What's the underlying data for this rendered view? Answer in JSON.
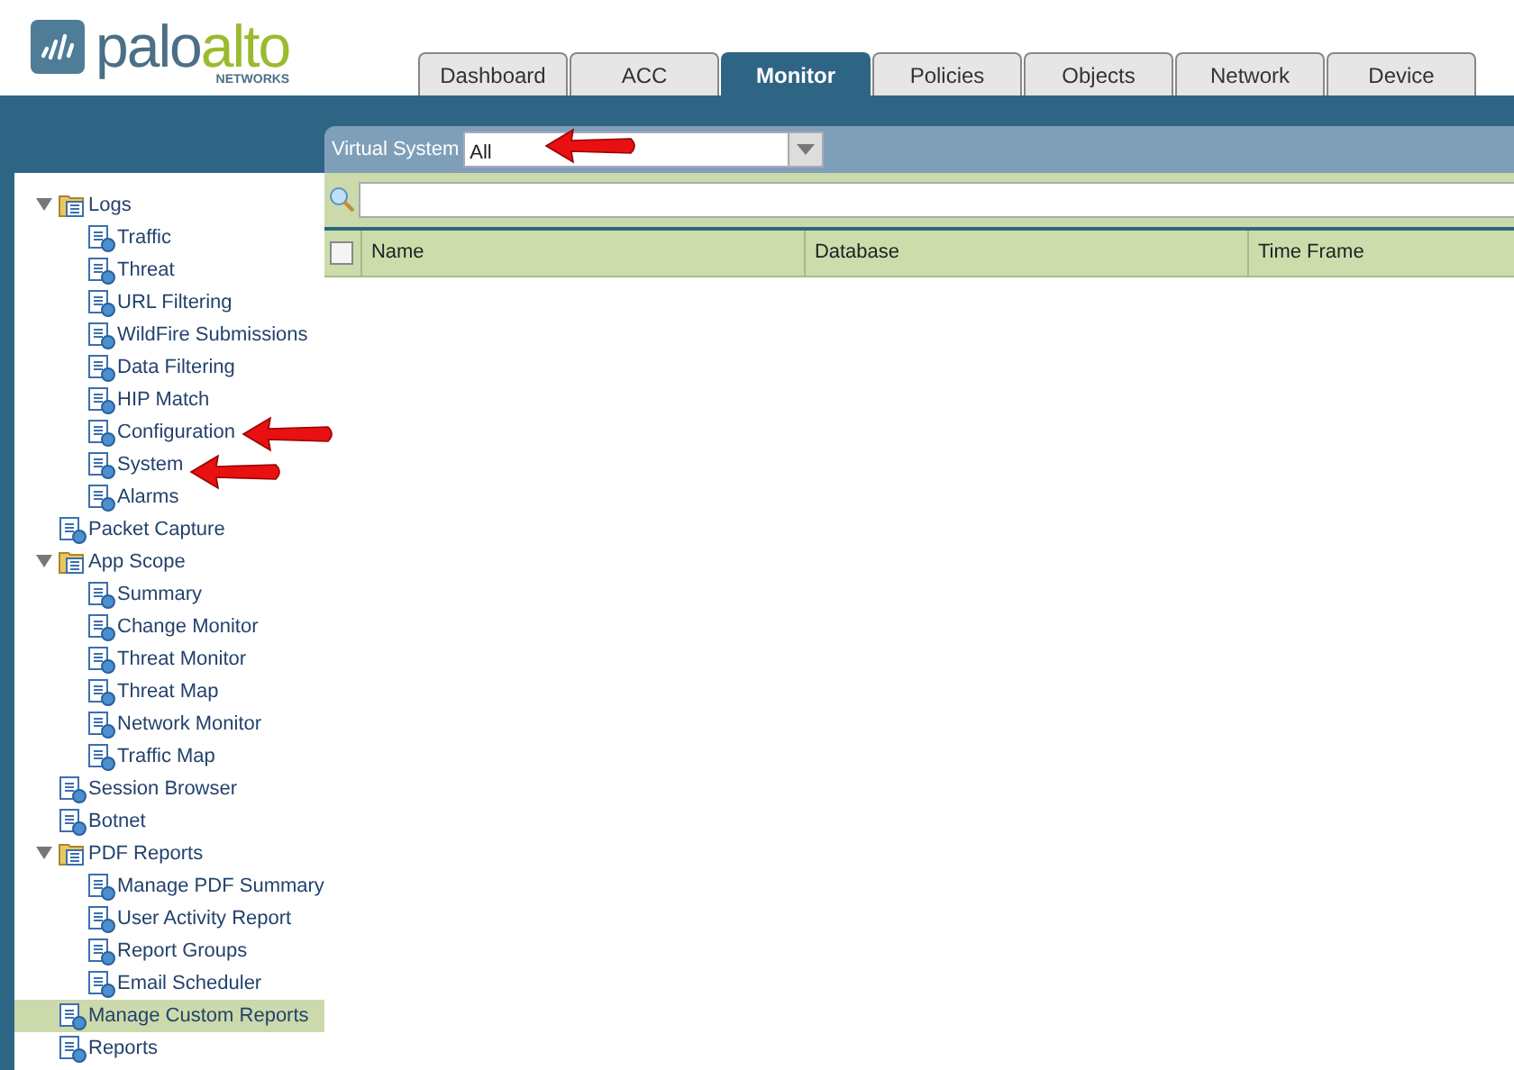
{
  "logo": {
    "word_1": "palo",
    "word_2": "alto",
    "subtitle": "NETWORKS"
  },
  "tabs": [
    {
      "label": "Dashboard",
      "selected": false
    },
    {
      "label": "ACC",
      "selected": false
    },
    {
      "label": "Monitor",
      "selected": true
    },
    {
      "label": "Policies",
      "selected": false
    },
    {
      "label": "Objects",
      "selected": false
    },
    {
      "label": "Network",
      "selected": false
    },
    {
      "label": "Device",
      "selected": false
    }
  ],
  "tree": [
    {
      "label": "Logs",
      "expanded": true,
      "selected": false,
      "children": [
        {
          "label": "Traffic",
          "selected": false
        },
        {
          "label": "Threat",
          "selected": false
        },
        {
          "label": "URL Filtering",
          "selected": false
        },
        {
          "label": "WildFire Submissions",
          "selected": false
        },
        {
          "label": "Data Filtering",
          "selected": false
        },
        {
          "label": "HIP Match",
          "selected": false
        },
        {
          "label": "Configuration",
          "selected": false
        },
        {
          "label": "System",
          "selected": false
        },
        {
          "label": "Alarms",
          "selected": false
        }
      ]
    },
    {
      "label": "Packet Capture",
      "selected": false
    },
    {
      "label": "App Scope",
      "expanded": true,
      "selected": false,
      "children": [
        {
          "label": "Summary",
          "selected": false
        },
        {
          "label": "Change Monitor",
          "selected": false
        },
        {
          "label": "Threat Monitor",
          "selected": false
        },
        {
          "label": "Threat Map",
          "selected": false
        },
        {
          "label": "Network Monitor",
          "selected": false
        },
        {
          "label": "Traffic Map",
          "selected": false
        }
      ]
    },
    {
      "label": "Session Browser",
      "selected": false
    },
    {
      "label": "Botnet",
      "selected": false
    },
    {
      "label": "PDF Reports",
      "expanded": true,
      "selected": false,
      "children": [
        {
          "label": "Manage PDF Summary",
          "selected": false
        },
        {
          "label": "User Activity Report",
          "selected": false
        },
        {
          "label": "Report Groups",
          "selected": false
        },
        {
          "label": "Email Scheduler",
          "selected": false
        }
      ]
    },
    {
      "label": "Manage Custom Reports",
      "selected": true
    },
    {
      "label": "Reports",
      "selected": false
    }
  ],
  "virtual_system": {
    "label": "Virtual System",
    "value": "All"
  },
  "table": {
    "select_all_checked": false,
    "columns": [
      "Name",
      "Database",
      "Time Frame"
    ]
  }
}
